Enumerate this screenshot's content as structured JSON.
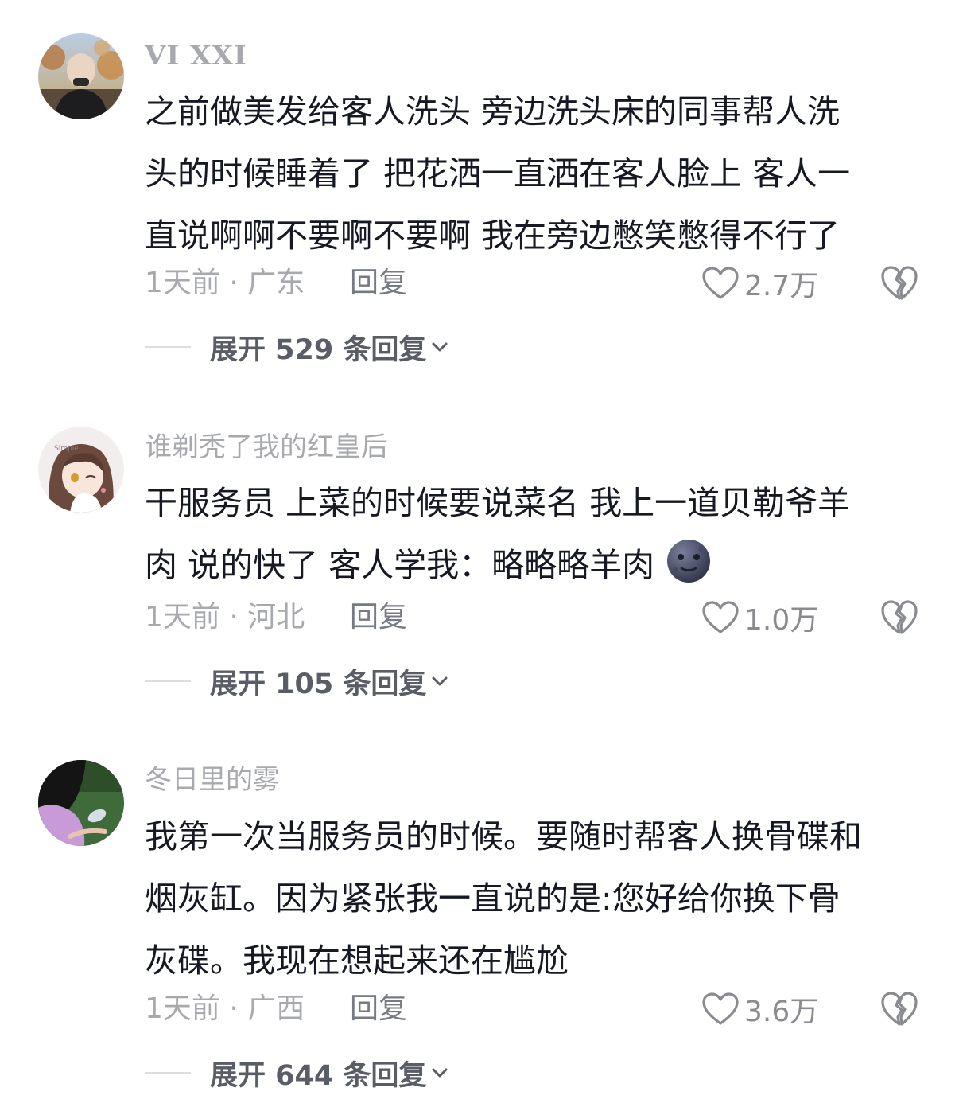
{
  "comments": [
    {
      "username": "VI XXI",
      "lines": [
        "之前做美发给客人洗头 旁边洗头床的同事帮人洗",
        "头的时候睡着了 把花洒一直洒在客人脸上 客人一",
        "直说啊啊不要啊不要啊 我在旁边憋笑憋得不行了"
      ],
      "meta": "1天前 · 广东",
      "reply_label": "回复",
      "likes": "2.7万",
      "expand_label": "展开 529 条回复",
      "avatar_icon": "user-avatar-photo"
    },
    {
      "username": "谁剃秃了我的红皇后",
      "lines": [
        "干服务员 上菜的时候要说菜名 我上一道贝勒爷羊",
        "肉 说的快了 客人学我：略略略羊肉"
      ],
      "emoji_icon": "moon-face-emoji",
      "meta": "1天前 · 河北",
      "reply_label": "回复",
      "likes": "1.0万",
      "expand_label": "展开 105 条回复",
      "avatar_icon": "anime-avatar",
      "avatar_badge": "Simple"
    },
    {
      "username": "冬日里的雾",
      "lines": [
        "我第一次当服务员的时候。要随时帮客人换骨碟和",
        "烟灰缸。因为紧张我一直说的是:您好给你换下骨",
        "灰碟。我现在想起来还在尴尬"
      ],
      "meta": "1天前 · 广西",
      "reply_label": "回复",
      "likes": "3.6万",
      "expand_label": "展开 644 条回复",
      "avatar_icon": "user-avatar-photo"
    }
  ],
  "icons": {
    "like": "heart-outline-icon",
    "dislike": "broken-heart-icon",
    "expand": "chevron-down-icon"
  },
  "colors": {
    "username": "#a7a9ae",
    "text": "#161823",
    "meta": "#a7a9ae",
    "reply": "#767a82",
    "expand": "#5a5d66"
  }
}
